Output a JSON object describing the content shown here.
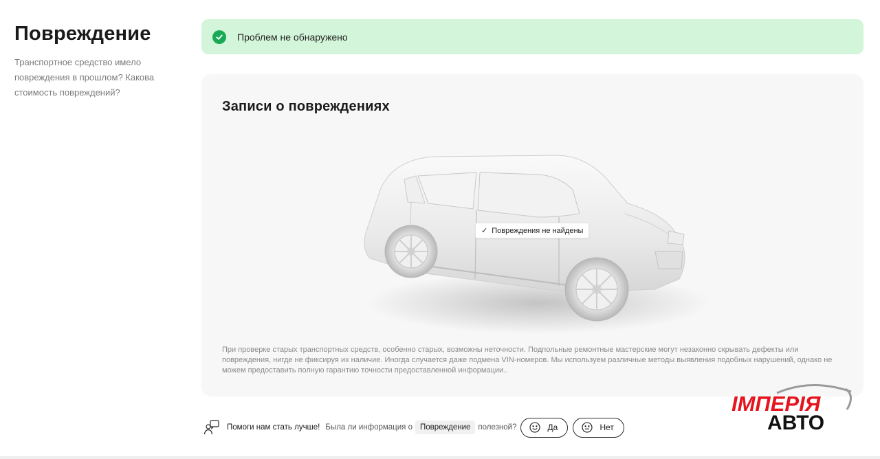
{
  "section": {
    "title": "Повреждение",
    "description": "Транспортное средство имело повреждения в прошлом? Какова стоимость повреждений?"
  },
  "status_banner": {
    "text": "Проблем не обнаружено",
    "icon": "check-circle-icon",
    "color": "#1aaa55",
    "background": "#d3f5da"
  },
  "damage_card": {
    "title": "Записи о повреждениях",
    "car_tag": "Повреждения не найдены",
    "disclaimer": "При проверке старых транспортных средств, особенно старых, возможны неточности. Подпольные ремонтные мастерские могут незаконно скрывать дефекты или повреждения, нигде не фиксируя их наличие. Иногда случается даже подмена VIN-номеров. Мы используем различные методы выявления подобных нарушений, однако не можем предоставить полную гарантию точности предоставленной информации.."
  },
  "feedback": {
    "lead": "Помоги нам стать лучше!",
    "question_start": "Была ли информация о",
    "topic": "Повреждение",
    "question_end": "полезной?",
    "yes_label": "Да",
    "no_label": "Нет"
  },
  "logo": {
    "line1": "ІМПЕРІЯ",
    "line2": "АВТО",
    "accent_color": "#e5141d"
  }
}
